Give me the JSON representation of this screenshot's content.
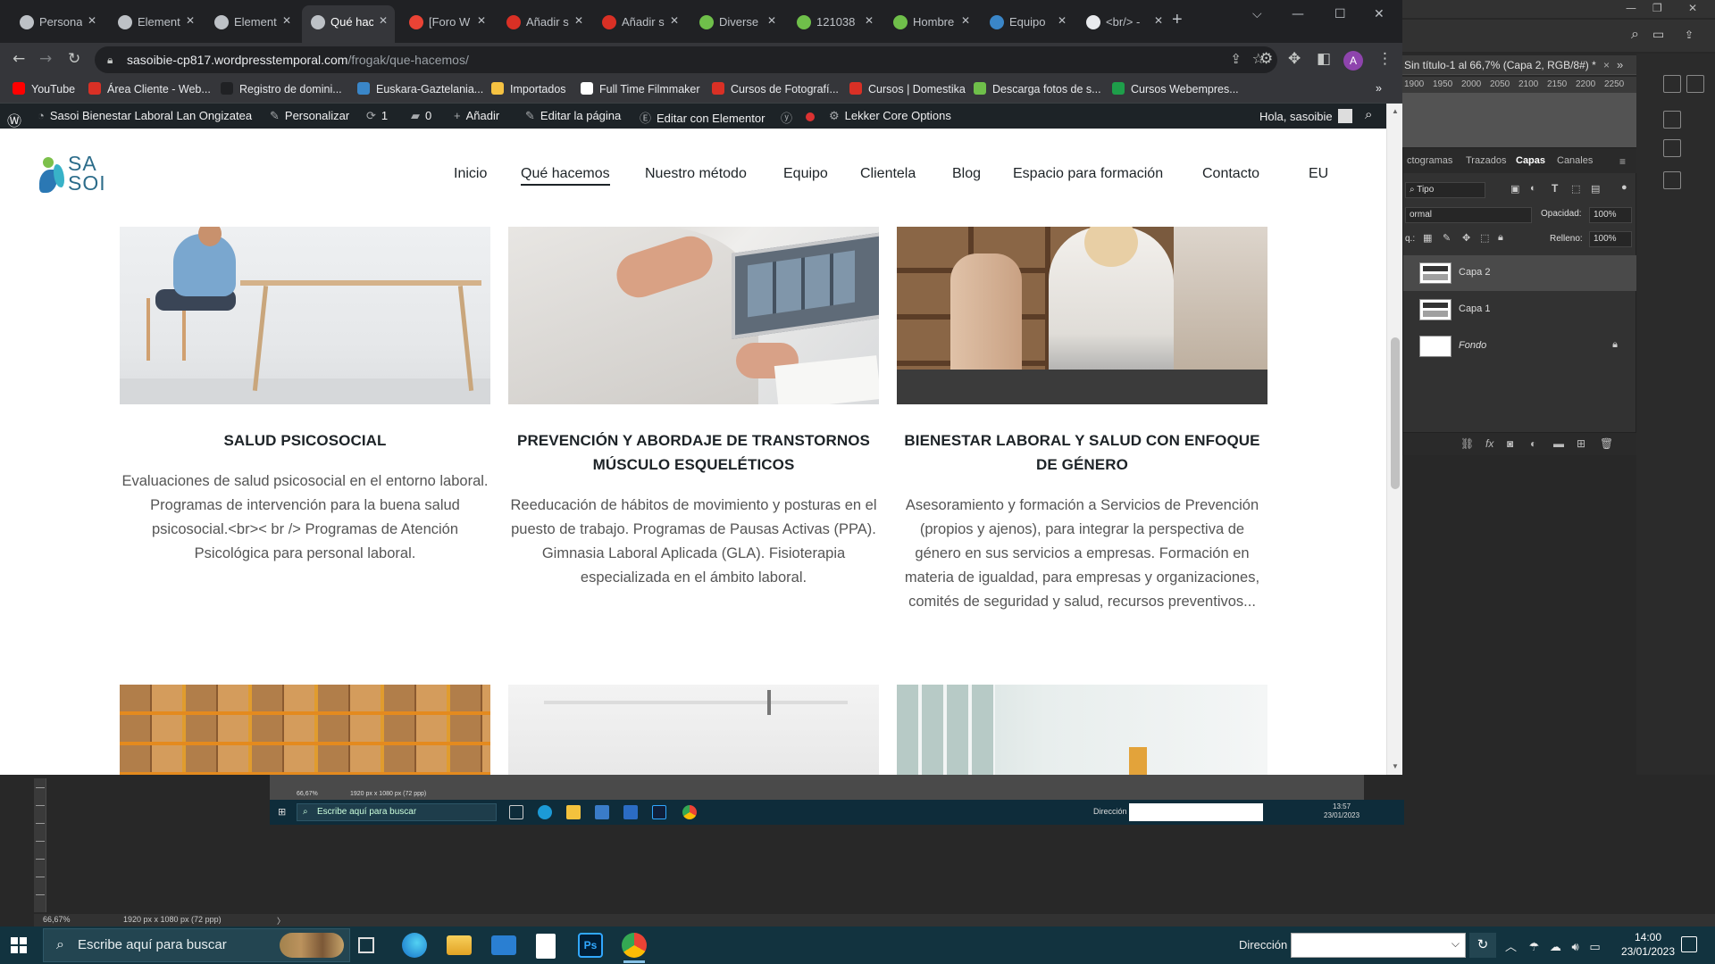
{
  "chrome": {
    "tabs": [
      {
        "label": "Persona",
        "fav_color": "#bdc1c6"
      },
      {
        "label": "Element",
        "fav_color": "#bdc1c6"
      },
      {
        "label": "Element",
        "fav_color": "#bdc1c6"
      },
      {
        "label": "Qué hac",
        "fav_color": "#bdc1c6",
        "active": true
      },
      {
        "label": "[Foro W",
        "fav_color": "#ea4335"
      },
      {
        "label": "Añadir s",
        "fav_color": "#d93025"
      },
      {
        "label": "Añadir s",
        "fav_color": "#d93025"
      },
      {
        "label": "Diverse",
        "fav_color": "#6fbf4a"
      },
      {
        "label": "121038",
        "fav_color": "#6fbf4a"
      },
      {
        "label": "Hombre",
        "fav_color": "#6fbf4a"
      },
      {
        "label": "Equipo",
        "fav_color": "#3a86c8"
      },
      {
        "label": "<br/> -",
        "fav_color": "#e8eaed"
      }
    ],
    "url_host": "sasoibie-cp817.wordpresstemporal.com",
    "url_path": "/frogak/que-hacemos/",
    "profile_initial": "A",
    "bookmarks": [
      {
        "label": "YouTube",
        "color": "#ff0000"
      },
      {
        "label": "Área Cliente - Web...",
        "color": "#d93025"
      },
      {
        "label": "Registro de domini...",
        "color": "#202124"
      },
      {
        "label": "Euskara-Gaztelania...",
        "color": "#3a86c8"
      },
      {
        "label": "Importados",
        "color": "#f5c242"
      },
      {
        "label": "Full Time Filmmaker",
        "color": "#ffffff"
      },
      {
        "label": "Cursos de Fotografí...",
        "color": "#d93025"
      },
      {
        "label": "Cursos | Domestika",
        "color": "#d93025"
      },
      {
        "label": "Descarga fotos de s...",
        "color": "#6fbf4a"
      },
      {
        "label": "Cursos Webempres...",
        "color": "#1e9e4a"
      }
    ]
  },
  "wpbar": {
    "site_name": "Sasoi Bienestar Laboral Lan Ongizatea",
    "customize": "Personalizar",
    "updates": "1",
    "comments": "0",
    "add": "Añadir",
    "edit_page": "Editar la página",
    "edit_elementor": "Editar con Elementor",
    "lekker": "Lekker Core Options",
    "greeting": "Hola, sasoibie"
  },
  "site": {
    "logo_line1": "SA",
    "logo_line2": "SOI",
    "nav": [
      "Inicio",
      "Qué hacemos",
      "Nuestro método",
      "Equipo",
      "Clientela",
      "Blog",
      "Espacio para formación",
      "Contacto",
      "EU"
    ],
    "cards": [
      {
        "title": "SALUD PSICOSOCIAL",
        "text": "Evaluaciones de salud psicosocial en el entorno laboral. Programas de intervención para la buena salud psicosocial.<br>< br /> Programas de Atención Psicológica para personal laboral."
      },
      {
        "title": "PREVENCIÓN Y ABORDAJE DE TRANSTORNOS MÚSCULO ESQUELÉTICOS",
        "text": "Reeducación de hábitos de movimiento y posturas en el puesto de trabajo. Programas de Pausas Activas (PPA). Gimnasia Laboral Aplicada (GLA). Fisioterapia especializada en el ámbito laboral."
      },
      {
        "title": "BIENESTAR LABORAL Y SALUD CON ENFOQUE DE GÉNERO",
        "text": "Asesoramiento y formación a Servicios de Prevención (propios y ajenos), para integrar la perspectiva de género en sus servicios a empresas. Formación en materia de igualdad, para empresas y organizaciones, comités de seguridad y salud, recursos preventivos..."
      }
    ]
  },
  "photoshop": {
    "doc_tab": "Sin título-1 al 66,7% (Capa 2, RGB/8#) *",
    "ruler_marks": [
      "1900",
      "1950",
      "2000",
      "2050",
      "2100",
      "2150",
      "2200",
      "2250"
    ],
    "panel_tabs": [
      "ctogramas",
      "Trazados",
      "Capas",
      "Canales"
    ],
    "filter_label": "Tipo",
    "blend_mode": "ormal",
    "opacity_label": "Opacidad:",
    "opacity_value": "100%",
    "lock_label": "q.:",
    "fill_label": "Relleno:",
    "fill_value": "100%",
    "layers": [
      "Capa 2",
      "Capa 1",
      "Fondo"
    ],
    "status_zoom": "66,67%",
    "status_size": "1920 px x 1080 px (72 ppp)"
  },
  "inner_taskbar": {
    "search": "Escribe aquí para buscar",
    "dir_label": "Dirección",
    "time": "13:57",
    "date": "23/01/2023",
    "zoom": "66,67%",
    "size": "1920 px x 1080 px (72 ppp)"
  },
  "taskbar": {
    "search": "Escribe aquí para buscar",
    "dir_label": "Dirección",
    "time": "14:00",
    "date": "23/01/2023"
  }
}
